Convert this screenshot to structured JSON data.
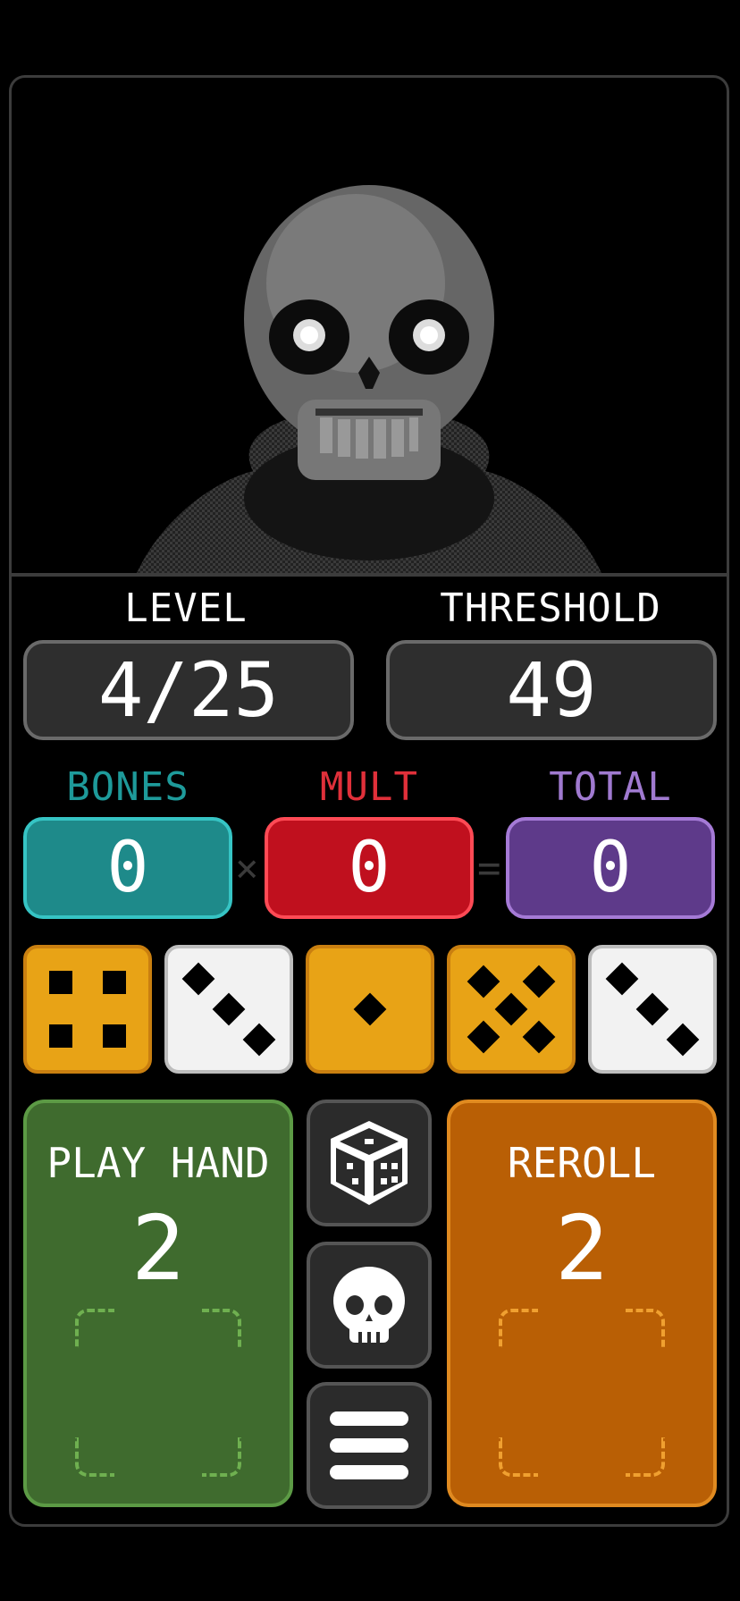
{
  "stats": {
    "level_label": "LEVEL",
    "level_value": "4/25",
    "threshold_label": "THRESHOLD",
    "threshold_value": "49"
  },
  "score": {
    "bones_label": "BONES",
    "bones_value": "0",
    "mult_label": "MULT",
    "mult_value": "0",
    "total_label": "TOTAL",
    "total_value": "0",
    "times_symbol": "×",
    "equals_symbol": "="
  },
  "dice": [
    {
      "face": 4,
      "color": "yellow"
    },
    {
      "face": 3,
      "color": "white"
    },
    {
      "face": 1,
      "color": "yellow"
    },
    {
      "face": 5,
      "color": "yellow"
    },
    {
      "face": 3,
      "color": "white"
    }
  ],
  "buttons": {
    "play_hand_label": "PLAY HAND",
    "play_hand_count": "2",
    "reroll_label": "REROLL",
    "reroll_count": "2"
  },
  "side_buttons": [
    "dice-icon",
    "skull-icon",
    "menu-icon"
  ],
  "colors": {
    "bones": "#1e8a8a",
    "mult": "#c0101e",
    "total": "#5e3a8a",
    "play_hand": "#3f6b2e",
    "reroll": "#b95f05",
    "die_yellow": "#e8a316"
  }
}
